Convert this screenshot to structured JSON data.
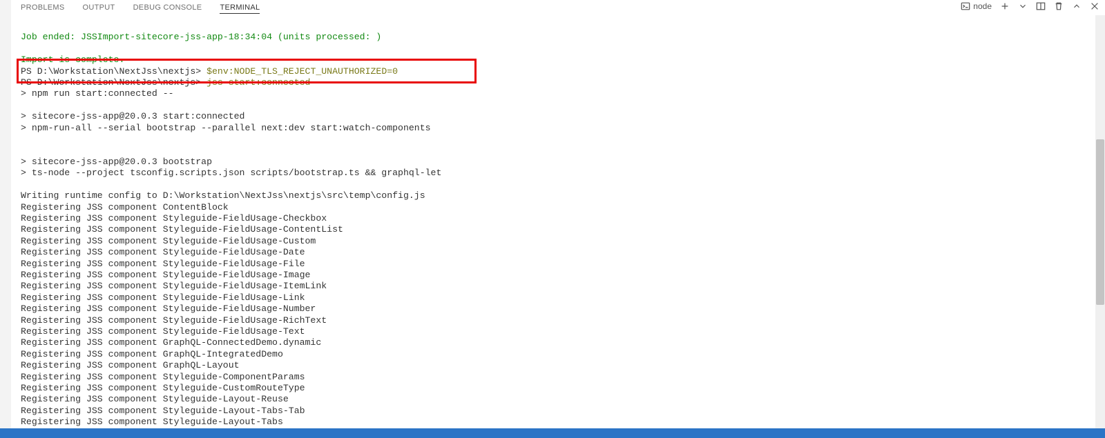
{
  "tabs": {
    "problems": "PROBLEMS",
    "output": "OUTPUT",
    "debug": "DEBUG CONSOLE",
    "terminal": "TERMINAL"
  },
  "shell": {
    "label": "node"
  },
  "terminal": {
    "job_ended": "Job ended: JSSImport-sitecore-jss-app-18:34:04 (units processed: )",
    "import_complete": "Import is complete.",
    "prompt1_path": "PS D:\\Workstation\\NextJss\\nextjs> ",
    "prompt1_cmd": "$env:NODE_TLS_REJECT_UNAUTHORIZED=0",
    "prompt2_path": "PS D:\\Workstation\\NextJss\\nextjs> ",
    "prompt2_cmd": "jss start:connected",
    "l1": "> npm run start:connected --",
    "l2": "",
    "l3": "> sitecore-jss-app@20.0.3 start:connected",
    "l4": "> npm-run-all --serial bootstrap --parallel next:dev start:watch-components",
    "l5": "",
    "l6": "",
    "l7": "> sitecore-jss-app@20.0.3 bootstrap",
    "l8": "> ts-node --project tsconfig.scripts.json scripts/bootstrap.ts && graphql-let",
    "l9": "",
    "l10": "Writing runtime config to D:\\Workstation\\NextJss\\nextjs\\src\\temp\\config.js",
    "l11": "Registering JSS component ContentBlock",
    "l12": "Registering JSS component Styleguide-FieldUsage-Checkbox",
    "l13": "Registering JSS component Styleguide-FieldUsage-ContentList",
    "l14": "Registering JSS component Styleguide-FieldUsage-Custom",
    "l15": "Registering JSS component Styleguide-FieldUsage-Date",
    "l16": "Registering JSS component Styleguide-FieldUsage-File",
    "l17": "Registering JSS component Styleguide-FieldUsage-Image",
    "l18": "Registering JSS component Styleguide-FieldUsage-ItemLink",
    "l19": "Registering JSS component Styleguide-FieldUsage-Link",
    "l20": "Registering JSS component Styleguide-FieldUsage-Number",
    "l21": "Registering JSS component Styleguide-FieldUsage-RichText",
    "l22": "Registering JSS component Styleguide-FieldUsage-Text",
    "l23": "Registering JSS component GraphQL-ConnectedDemo.dynamic",
    "l24": "Registering JSS component GraphQL-IntegratedDemo",
    "l25": "Registering JSS component GraphQL-Layout",
    "l26": "Registering JSS component Styleguide-ComponentParams",
    "l27": "Registering JSS component Styleguide-CustomRouteType",
    "l28": "Registering JSS component Styleguide-Layout-Reuse",
    "l29": "Registering JSS component Styleguide-Layout-Tabs-Tab",
    "l30": "Registering JSS component Styleguide-Layout-Tabs"
  }
}
